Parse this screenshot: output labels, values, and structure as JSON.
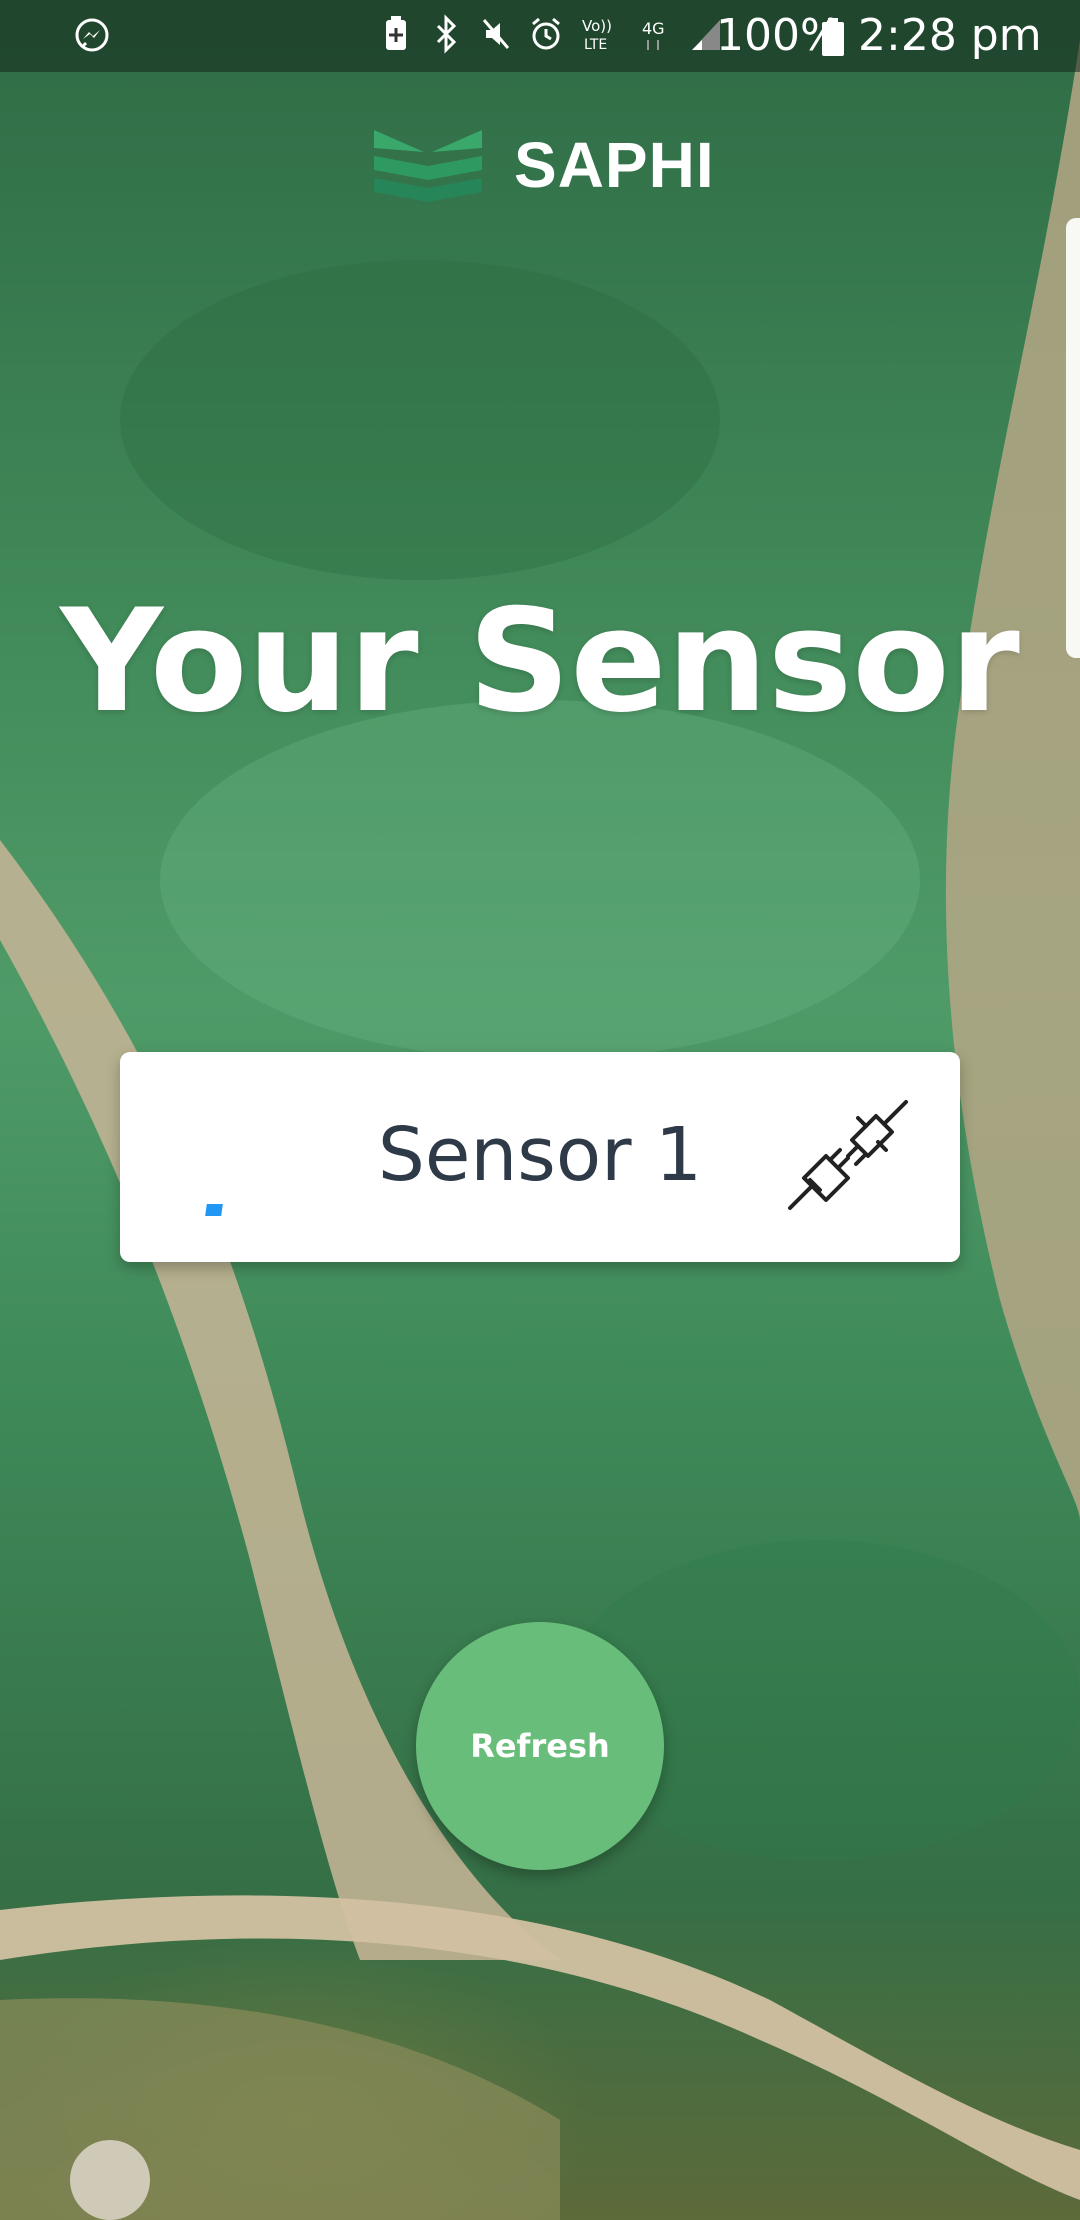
{
  "status_bar": {
    "notification_icons": [
      "messenger-icon"
    ],
    "system_icons": [
      "battery-saver-icon",
      "bluetooth-icon",
      "mute-icon",
      "alarm-icon",
      "volte-icon",
      "network-4g-icon",
      "signal-icon"
    ],
    "volte_label": "Vo)) LTE",
    "network_label": "4G",
    "battery_percent": "100%",
    "time": "2:28 pm"
  },
  "app": {
    "brand": "SAPHI",
    "logo_icon": "saphi-logo-icon"
  },
  "main": {
    "title": "Your Sensor",
    "sensor_card": {
      "name": "Sensor 1",
      "status_indicator_color": "#2196f3",
      "icon": "plug-connection-icon"
    },
    "refresh_button": {
      "label": "Refresh",
      "color": "#67bd79"
    }
  }
}
